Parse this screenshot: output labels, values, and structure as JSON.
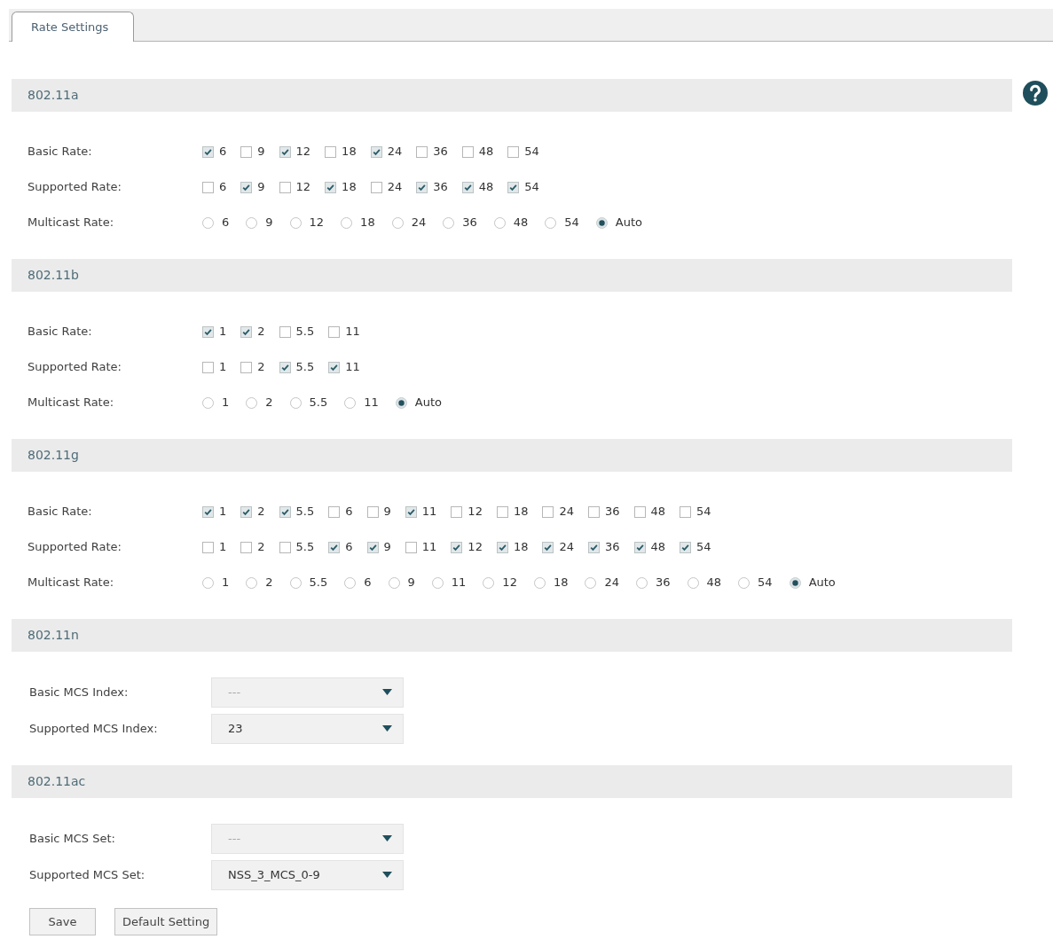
{
  "tabs": [
    {
      "label": "Rate Settings",
      "selected": true
    }
  ],
  "sections": [
    {
      "title": "802.11a",
      "rows": [
        {
          "kind": "checkbox",
          "label": "Basic Rate:",
          "options": [
            {
              "label": "6",
              "checked": true
            },
            {
              "label": "9",
              "checked": false
            },
            {
              "label": "12",
              "checked": true
            },
            {
              "label": "18",
              "checked": false
            },
            {
              "label": "24",
              "checked": true
            },
            {
              "label": "36",
              "checked": false
            },
            {
              "label": "48",
              "checked": false
            },
            {
              "label": "54",
              "checked": false
            }
          ]
        },
        {
          "kind": "checkbox",
          "label": "Supported Rate:",
          "options": [
            {
              "label": "6",
              "checked": false
            },
            {
              "label": "9",
              "checked": true
            },
            {
              "label": "12",
              "checked": false
            },
            {
              "label": "18",
              "checked": true
            },
            {
              "label": "24",
              "checked": false
            },
            {
              "label": "36",
              "checked": true
            },
            {
              "label": "48",
              "checked": true
            },
            {
              "label": "54",
              "checked": true
            }
          ]
        },
        {
          "kind": "radio",
          "label": "Multicast Rate:",
          "options": [
            {
              "label": "6",
              "selected": false
            },
            {
              "label": "9",
              "selected": false
            },
            {
              "label": "12",
              "selected": false
            },
            {
              "label": "18",
              "selected": false
            },
            {
              "label": "24",
              "selected": false
            },
            {
              "label": "36",
              "selected": false
            },
            {
              "label": "48",
              "selected": false
            },
            {
              "label": "54",
              "selected": false
            },
            {
              "label": "Auto",
              "selected": true
            }
          ]
        }
      ]
    },
    {
      "title": "802.11b",
      "rows": [
        {
          "kind": "checkbox",
          "label": "Basic Rate:",
          "options": [
            {
              "label": "1",
              "checked": true
            },
            {
              "label": "2",
              "checked": true
            },
            {
              "label": "5.5",
              "checked": false
            },
            {
              "label": "11",
              "checked": false
            }
          ]
        },
        {
          "kind": "checkbox",
          "label": "Supported Rate:",
          "options": [
            {
              "label": "1",
              "checked": false
            },
            {
              "label": "2",
              "checked": false
            },
            {
              "label": "5.5",
              "checked": true
            },
            {
              "label": "11",
              "checked": true
            }
          ]
        },
        {
          "kind": "radio",
          "label": "Multicast Rate:",
          "options": [
            {
              "label": "1",
              "selected": false
            },
            {
              "label": "2",
              "selected": false
            },
            {
              "label": "5.5",
              "selected": false
            },
            {
              "label": "11",
              "selected": false
            },
            {
              "label": "Auto",
              "selected": true
            }
          ]
        }
      ]
    },
    {
      "title": "802.11g",
      "rows": [
        {
          "kind": "checkbox",
          "label": "Basic Rate:",
          "options": [
            {
              "label": "1",
              "checked": true
            },
            {
              "label": "2",
              "checked": true
            },
            {
              "label": "5.5",
              "checked": true
            },
            {
              "label": "6",
              "checked": false
            },
            {
              "label": "9",
              "checked": false
            },
            {
              "label": "11",
              "checked": true
            },
            {
              "label": "12",
              "checked": false
            },
            {
              "label": "18",
              "checked": false
            },
            {
              "label": "24",
              "checked": false
            },
            {
              "label": "36",
              "checked": false
            },
            {
              "label": "48",
              "checked": false
            },
            {
              "label": "54",
              "checked": false
            }
          ]
        },
        {
          "kind": "checkbox",
          "label": "Supported Rate:",
          "options": [
            {
              "label": "1",
              "checked": false
            },
            {
              "label": "2",
              "checked": false
            },
            {
              "label": "5.5",
              "checked": false
            },
            {
              "label": "6",
              "checked": true
            },
            {
              "label": "9",
              "checked": true
            },
            {
              "label": "11",
              "checked": false
            },
            {
              "label": "12",
              "checked": true
            },
            {
              "label": "18",
              "checked": true
            },
            {
              "label": "24",
              "checked": true
            },
            {
              "label": "36",
              "checked": true
            },
            {
              "label": "48",
              "checked": true
            },
            {
              "label": "54",
              "checked": true
            }
          ]
        },
        {
          "kind": "radio",
          "label": "Multicast Rate:",
          "options": [
            {
              "label": "1",
              "selected": false
            },
            {
              "label": "2",
              "selected": false
            },
            {
              "label": "5.5",
              "selected": false
            },
            {
              "label": "6",
              "selected": false
            },
            {
              "label": "9",
              "selected": false
            },
            {
              "label": "11",
              "selected": false
            },
            {
              "label": "12",
              "selected": false
            },
            {
              "label": "18",
              "selected": false
            },
            {
              "label": "24",
              "selected": false
            },
            {
              "label": "36",
              "selected": false
            },
            {
              "label": "48",
              "selected": false
            },
            {
              "label": "54",
              "selected": false
            },
            {
              "label": "Auto",
              "selected": true
            }
          ]
        }
      ]
    },
    {
      "title": "802.11n",
      "rows": [
        {
          "kind": "select",
          "label": "Basic MCS Index:",
          "value": "---",
          "disabled": true
        },
        {
          "kind": "select",
          "label": "Supported MCS Index:",
          "value": "23",
          "disabled": false
        }
      ]
    },
    {
      "title": "802.11ac",
      "rows": [
        {
          "kind": "select",
          "label": "Basic MCS Set:",
          "value": "---",
          "disabled": true
        },
        {
          "kind": "select",
          "label": "Supported MCS Set:",
          "value": "NSS_3_MCS_0-9",
          "disabled": false
        }
      ]
    }
  ],
  "buttons": [
    {
      "label": "Save"
    },
    {
      "label": "Default Setting"
    }
  ]
}
